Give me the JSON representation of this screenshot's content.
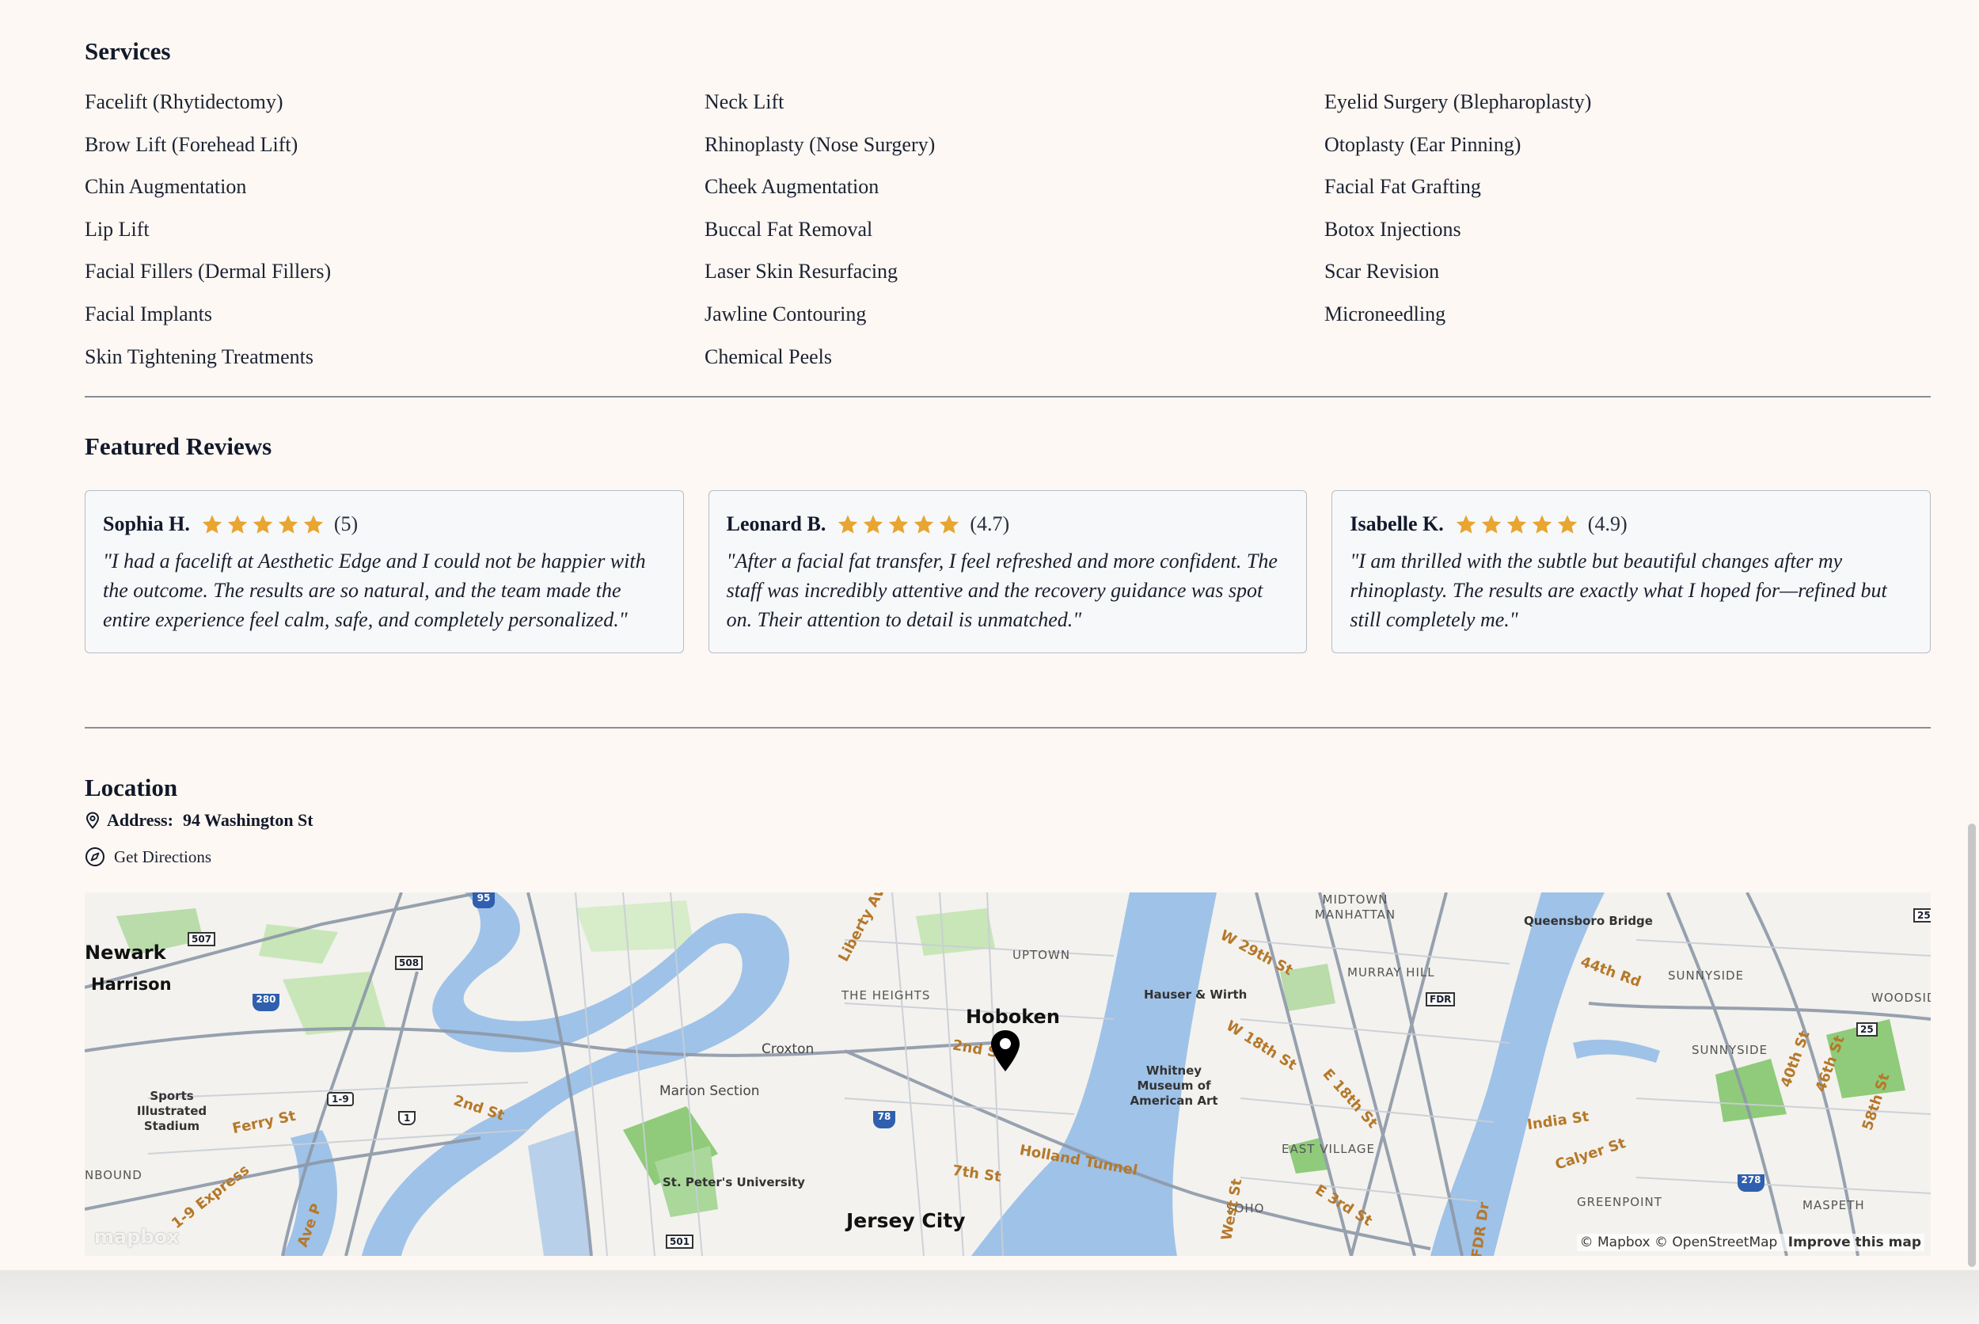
{
  "services": {
    "title": "Services",
    "items": [
      "Facelift (Rhytidectomy)",
      "Neck Lift",
      "Eyelid Surgery (Blepharoplasty)",
      "Brow Lift (Forehead Lift)",
      "Rhinoplasty (Nose Surgery)",
      "Otoplasty (Ear Pinning)",
      "Chin Augmentation",
      "Cheek Augmentation",
      "Facial Fat Grafting",
      "Lip Lift",
      "Buccal Fat Removal",
      "Botox Injections",
      "Facial Fillers (Dermal Fillers)",
      "Laser Skin Resurfacing",
      "Scar Revision",
      "Facial Implants",
      "Jawline Contouring",
      "Microneedling",
      "Skin Tightening Treatments",
      "Chemical Peels",
      ""
    ]
  },
  "reviews": {
    "title": "Featured Reviews",
    "items": [
      {
        "name": "Sophia H.",
        "rating": "(5)",
        "text": "\"I had a facelift at Aesthetic Edge and I could not be happier with the outcome. The results are so natural, and the team made the entire experience feel calm, safe, and completely personalized.\""
      },
      {
        "name": "Leonard B.",
        "rating": "(4.7)",
        "text": "\"After a facial fat transfer, I feel refreshed and more confident. The staff was incredibly attentive and the recovery guidance was spot on. Their attention to detail is unmatched.\""
      },
      {
        "name": "Isabelle K.",
        "rating": "(4.9)",
        "text": "\"I am thrilled with the subtle but beautiful changes after my rhinoplasty. The results are exactly what I hoped for—refined but still completely me.\""
      }
    ],
    "star_color": "#e8a530"
  },
  "location": {
    "title": "Location",
    "address_label": "Address:",
    "address_value": "94 Washington St",
    "directions_label": "Get Directions",
    "map": {
      "labels": {
        "newark": "Newark",
        "harrison": "Harrison",
        "hoboken": "Hoboken",
        "jersey_city": "Jersey City",
        "the_heights": "THE HEIGHTS",
        "uptown": "UPTOWN",
        "croxton": "Croxton",
        "marion_section": "Marion Section",
        "st_peters": "St. Peter's University",
        "sports_stadium": "Sports Illustrated Stadium",
        "hauser_wirth": "Hauser & Wirth",
        "whitney": "Whitney Museum of American Art",
        "midtown": "MIDTOWN MANHATTAN",
        "murray_hill": "MURRAY HILL",
        "east_village": "EAST VILLAGE",
        "soho": "SOHO",
        "sunnyside1": "SUNNYSIDE",
        "sunnyside2": "SUNNYSIDE",
        "woodside": "WOODSID",
        "greenpoint": "GREENPOINT",
        "maspeth": "MASPETH",
        "queensboro": "Queensboro Bridge",
        "nbound": "NBOUND",
        "holland_tunnel": "Holland Tunnel",
        "ferry_st": "Ferry St",
        "second_st": "2nd St",
        "seventh_st": "7th St",
        "india_st": "India St",
        "calyer_st": "Calyer St",
        "w29": "W 29th St",
        "w18": "W 18th St",
        "e18": "E 18th St",
        "e3": "E 3rd St",
        "ave_p": "Ave P",
        "express": "1-9 Express",
        "liberty": "Liberty Av",
        "st_44": "44th Rd",
        "st_40": "40th St",
        "st_46": "46th St",
        "st_58": "58th St",
        "west_st": "West St",
        "fdr_dr": "FDR Dr",
        "hoboken_2nd": "2nd St"
      },
      "shields": {
        "i95": "95",
        "r507": "507",
        "r508": "508",
        "i280": "280",
        "r19": "1-9",
        "truck1": "1",
        "i78": "78",
        "r501": "501",
        "fdr": "FDR",
        "r25": "25",
        "i278": "278",
        "r25b": "25"
      },
      "logo": "mapbox",
      "attribution": "© Mapbox © OpenStreetMap",
      "improve": "Improve this map"
    }
  }
}
